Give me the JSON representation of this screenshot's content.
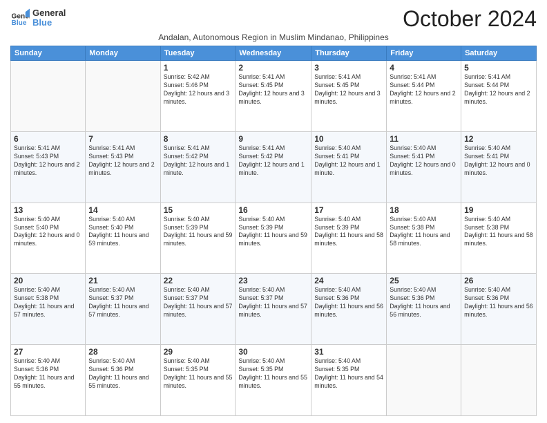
{
  "logo": {
    "line1": "General",
    "line2": "Blue"
  },
  "title": "October 2024",
  "subtitle": "Andalan, Autonomous Region in Muslim Mindanao, Philippines",
  "days_header": [
    "Sunday",
    "Monday",
    "Tuesday",
    "Wednesday",
    "Thursday",
    "Friday",
    "Saturday"
  ],
  "weeks": [
    [
      {
        "day": "",
        "info": ""
      },
      {
        "day": "",
        "info": ""
      },
      {
        "day": "1",
        "info": "Sunrise: 5:42 AM\nSunset: 5:46 PM\nDaylight: 12 hours and 3 minutes."
      },
      {
        "day": "2",
        "info": "Sunrise: 5:41 AM\nSunset: 5:45 PM\nDaylight: 12 hours and 3 minutes."
      },
      {
        "day": "3",
        "info": "Sunrise: 5:41 AM\nSunset: 5:45 PM\nDaylight: 12 hours and 3 minutes."
      },
      {
        "day": "4",
        "info": "Sunrise: 5:41 AM\nSunset: 5:44 PM\nDaylight: 12 hours and 2 minutes."
      },
      {
        "day": "5",
        "info": "Sunrise: 5:41 AM\nSunset: 5:44 PM\nDaylight: 12 hours and 2 minutes."
      }
    ],
    [
      {
        "day": "6",
        "info": "Sunrise: 5:41 AM\nSunset: 5:43 PM\nDaylight: 12 hours and 2 minutes."
      },
      {
        "day": "7",
        "info": "Sunrise: 5:41 AM\nSunset: 5:43 PM\nDaylight: 12 hours and 2 minutes."
      },
      {
        "day": "8",
        "info": "Sunrise: 5:41 AM\nSunset: 5:42 PM\nDaylight: 12 hours and 1 minute."
      },
      {
        "day": "9",
        "info": "Sunrise: 5:41 AM\nSunset: 5:42 PM\nDaylight: 12 hours and 1 minute."
      },
      {
        "day": "10",
        "info": "Sunrise: 5:40 AM\nSunset: 5:41 PM\nDaylight: 12 hours and 1 minute."
      },
      {
        "day": "11",
        "info": "Sunrise: 5:40 AM\nSunset: 5:41 PM\nDaylight: 12 hours and 0 minutes."
      },
      {
        "day": "12",
        "info": "Sunrise: 5:40 AM\nSunset: 5:41 PM\nDaylight: 12 hours and 0 minutes."
      }
    ],
    [
      {
        "day": "13",
        "info": "Sunrise: 5:40 AM\nSunset: 5:40 PM\nDaylight: 12 hours and 0 minutes."
      },
      {
        "day": "14",
        "info": "Sunrise: 5:40 AM\nSunset: 5:40 PM\nDaylight: 11 hours and 59 minutes."
      },
      {
        "day": "15",
        "info": "Sunrise: 5:40 AM\nSunset: 5:39 PM\nDaylight: 11 hours and 59 minutes."
      },
      {
        "day": "16",
        "info": "Sunrise: 5:40 AM\nSunset: 5:39 PM\nDaylight: 11 hours and 59 minutes."
      },
      {
        "day": "17",
        "info": "Sunrise: 5:40 AM\nSunset: 5:39 PM\nDaylight: 11 hours and 58 minutes."
      },
      {
        "day": "18",
        "info": "Sunrise: 5:40 AM\nSunset: 5:38 PM\nDaylight: 11 hours and 58 minutes."
      },
      {
        "day": "19",
        "info": "Sunrise: 5:40 AM\nSunset: 5:38 PM\nDaylight: 11 hours and 58 minutes."
      }
    ],
    [
      {
        "day": "20",
        "info": "Sunrise: 5:40 AM\nSunset: 5:38 PM\nDaylight: 11 hours and 57 minutes."
      },
      {
        "day": "21",
        "info": "Sunrise: 5:40 AM\nSunset: 5:37 PM\nDaylight: 11 hours and 57 minutes."
      },
      {
        "day": "22",
        "info": "Sunrise: 5:40 AM\nSunset: 5:37 PM\nDaylight: 11 hours and 57 minutes."
      },
      {
        "day": "23",
        "info": "Sunrise: 5:40 AM\nSunset: 5:37 PM\nDaylight: 11 hours and 57 minutes."
      },
      {
        "day": "24",
        "info": "Sunrise: 5:40 AM\nSunset: 5:36 PM\nDaylight: 11 hours and 56 minutes."
      },
      {
        "day": "25",
        "info": "Sunrise: 5:40 AM\nSunset: 5:36 PM\nDaylight: 11 hours and 56 minutes."
      },
      {
        "day": "26",
        "info": "Sunrise: 5:40 AM\nSunset: 5:36 PM\nDaylight: 11 hours and 56 minutes."
      }
    ],
    [
      {
        "day": "27",
        "info": "Sunrise: 5:40 AM\nSunset: 5:36 PM\nDaylight: 11 hours and 55 minutes."
      },
      {
        "day": "28",
        "info": "Sunrise: 5:40 AM\nSunset: 5:36 PM\nDaylight: 11 hours and 55 minutes."
      },
      {
        "day": "29",
        "info": "Sunrise: 5:40 AM\nSunset: 5:35 PM\nDaylight: 11 hours and 55 minutes."
      },
      {
        "day": "30",
        "info": "Sunrise: 5:40 AM\nSunset: 5:35 PM\nDaylight: 11 hours and 55 minutes."
      },
      {
        "day": "31",
        "info": "Sunrise: 5:40 AM\nSunset: 5:35 PM\nDaylight: 11 hours and 54 minutes."
      },
      {
        "day": "",
        "info": ""
      },
      {
        "day": "",
        "info": ""
      }
    ]
  ]
}
